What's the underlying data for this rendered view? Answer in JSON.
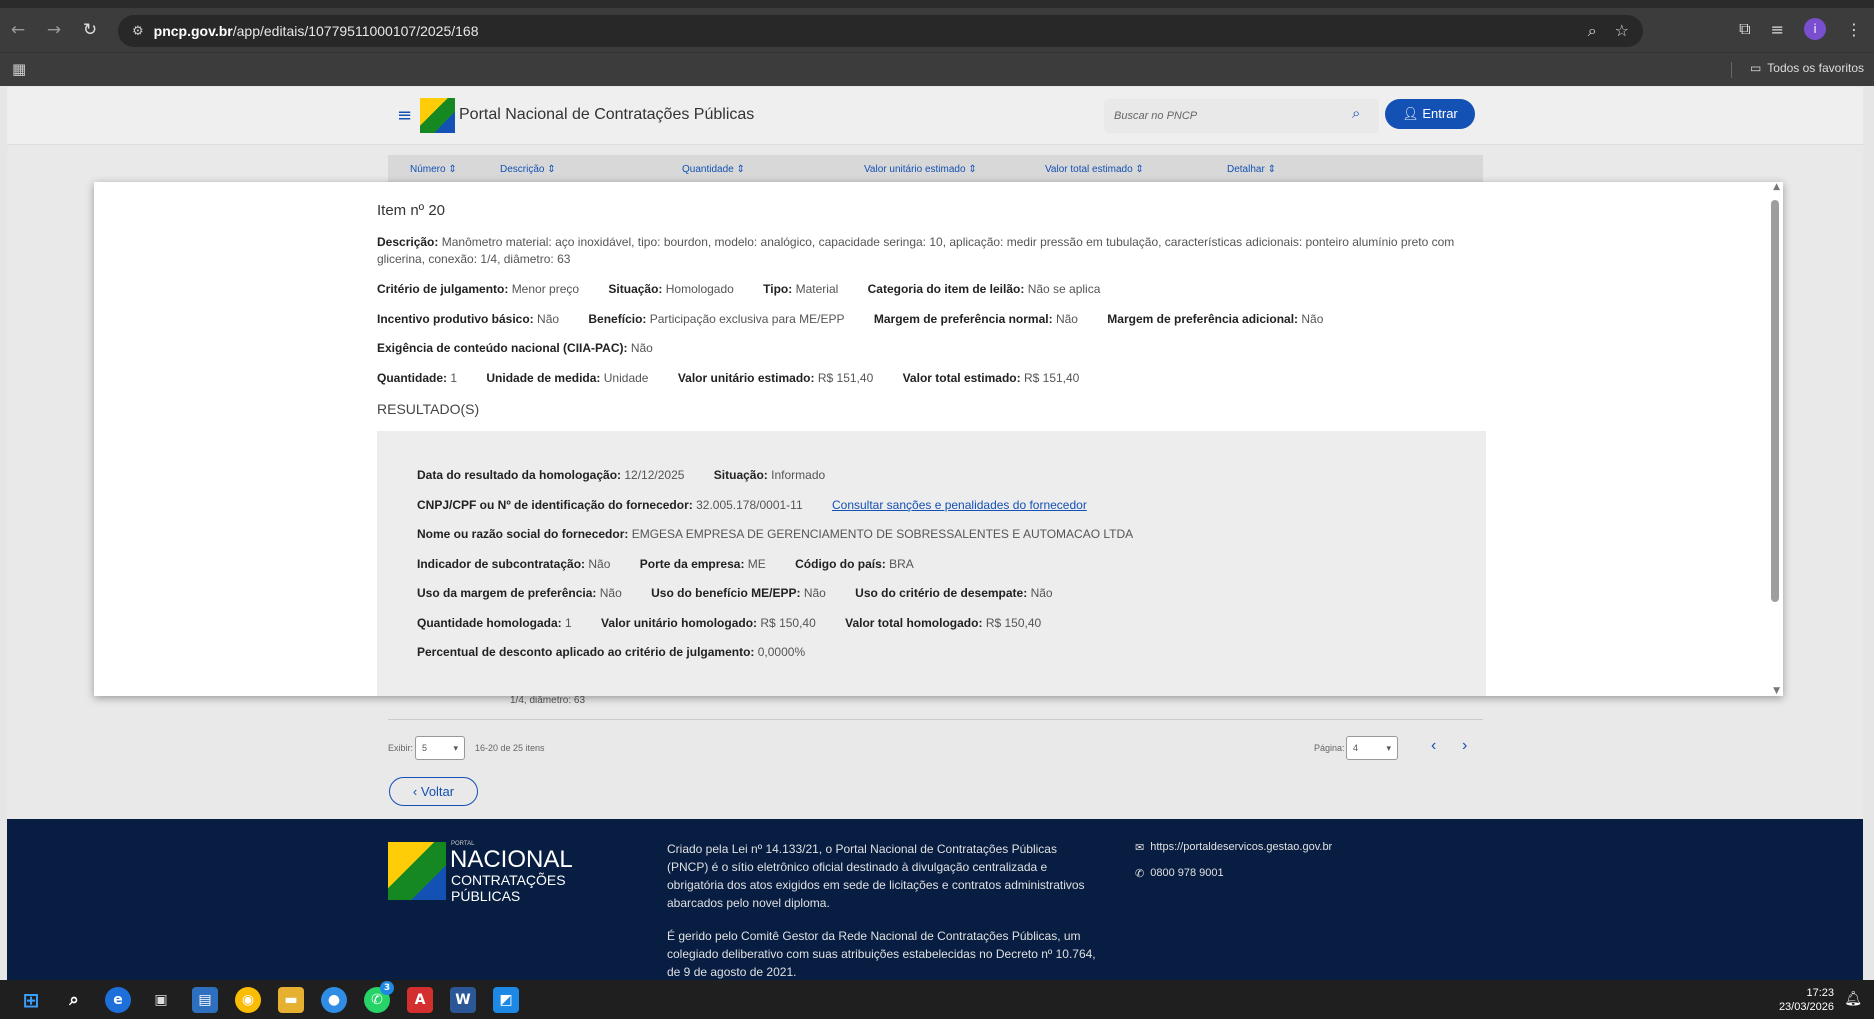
{
  "browser": {
    "url_host": "pncp.gov.br",
    "url_path": "/app/editais/10779511000107/2025/168",
    "bookmarks_label": "Todos os favoritos",
    "profile_initial": "i"
  },
  "site": {
    "title": "Portal Nacional de Contratações Públicas",
    "search_placeholder": "Buscar no PNCP",
    "login_label": "Entrar"
  },
  "table": {
    "headers": [
      "Número",
      "Descrição",
      "Quantidade",
      "Valor unitário estimado",
      "Valor total estimado",
      "Detalhar"
    ],
    "behind_text": "1/4, diâmetro: 63"
  },
  "pager": {
    "exibir_label": "Exibir:",
    "exibir_value": "5",
    "range": "16-20 de 25 itens",
    "pagina_label": "Página:",
    "pagina_value": "4"
  },
  "back_label": "Voltar",
  "item": {
    "title": "Item nº 20",
    "descricao_label": "Descrição:",
    "descricao": "Manômetro material: aço inoxidável, tipo: bourdon, modelo: analógico, capacidade seringa: 10, aplicação: medir pressão em tubulação, características adicionais: ponteiro alumínio preto com glicerina, conexão: 1/4, diâmetro: 63",
    "criterio_label": "Critério de julgamento:",
    "criterio": "Menor preço",
    "situacao_label": "Situação:",
    "situacao": "Homologado",
    "tipo_label": "Tipo:",
    "tipo": "Material",
    "categoria_label": "Categoria do item de leilão:",
    "categoria": "Não se aplica",
    "incentivo_label": "Incentivo produtivo básico:",
    "incentivo": "Não",
    "beneficio_label": "Benefício:",
    "beneficio": "Participação exclusiva para ME/EPP",
    "margem_normal_label": "Margem de preferência normal:",
    "margem_normal": "Não",
    "margem_adicional_label": "Margem de preferência adicional:",
    "margem_adicional": "Não",
    "exigencia_label": "Exigência de conteúdo nacional (CIIA-PAC):",
    "exigencia": "Não",
    "quantidade_label": "Quantidade:",
    "quantidade": "1",
    "unidade_label": "Unidade de medida:",
    "unidade": "Unidade",
    "valor_unit_label": "Valor unitário estimado:",
    "valor_unit": "R$ 151,40",
    "valor_total_label": "Valor total estimado:",
    "valor_total": "R$ 151,40",
    "resultados_label": "RESULTADO(S)"
  },
  "result": {
    "data_label": "Data do resultado da homologação:",
    "data": "12/12/2025",
    "situacao_label": "Situação:",
    "situacao": "Informado",
    "cnpj_label": "CNPJ/CPF ou Nº de identificação do fornecedor:",
    "cnpj": "32.005.178/0001-11",
    "sancoes_link": "Consultar sanções e penalidades do fornecedor",
    "nome_label": "Nome ou razão social do fornecedor:",
    "nome": "EMGESA EMPRESA DE GERENCIAMENTO DE SOBRESSALENTES E AUTOMACAO LTDA",
    "subcontr_label": "Indicador de subcontratação:",
    "subcontr": "Não",
    "porte_label": "Porte da empresa:",
    "porte": "ME",
    "pais_label": "Código do país:",
    "pais": "BRA",
    "uso_margem_label": "Uso da margem de preferência:",
    "uso_margem": "Não",
    "uso_beneficio_label": "Uso do benefício ME/EPP:",
    "uso_beneficio": "Não",
    "uso_desempate_label": "Uso do critério de desempate:",
    "uso_desempate": "Não",
    "qtd_homol_label": "Quantidade homologada:",
    "qtd_homol": "1",
    "vu_homol_label": "Valor unitário homologado:",
    "vu_homol": "R$ 150,40",
    "vt_homol_label": "Valor total homologado:",
    "vt_homol": "R$ 150,40",
    "desconto_label": "Percentual de desconto aplicado ao critério de julgamento:",
    "desconto": "0,0000%"
  },
  "footer": {
    "logo_portal": "PORTAL",
    "logo_nacional": "NACIONAL",
    "logo_contratacoes": "CONTRATAÇÕES",
    "logo_publicas": "PÚBLICAS",
    "text1": "Criado pela Lei nº 14.133/21, o Portal Nacional de Contratações Públicas (PNCP) é o sítio eletrônico oficial destinado à divulgação centralizada e obrigatória dos atos exigidos em sede de licitações e contratos administrativos abarcados pelo novel diploma.",
    "text2": "É gerido pelo Comitê Gestor da Rede Nacional de Contratações Públicas, um colegiado deliberativo com suas atribuições estabelecidas no Decreto nº 10.764, de 9 de agosto de 2021.",
    "link": "https://portaldeservicos.gestao.gov.br",
    "phone": "0800 978 9001"
  },
  "taskbar": {
    "time": "17:23",
    "date": "23/03/2026",
    "whatsapp_badge": "3"
  }
}
